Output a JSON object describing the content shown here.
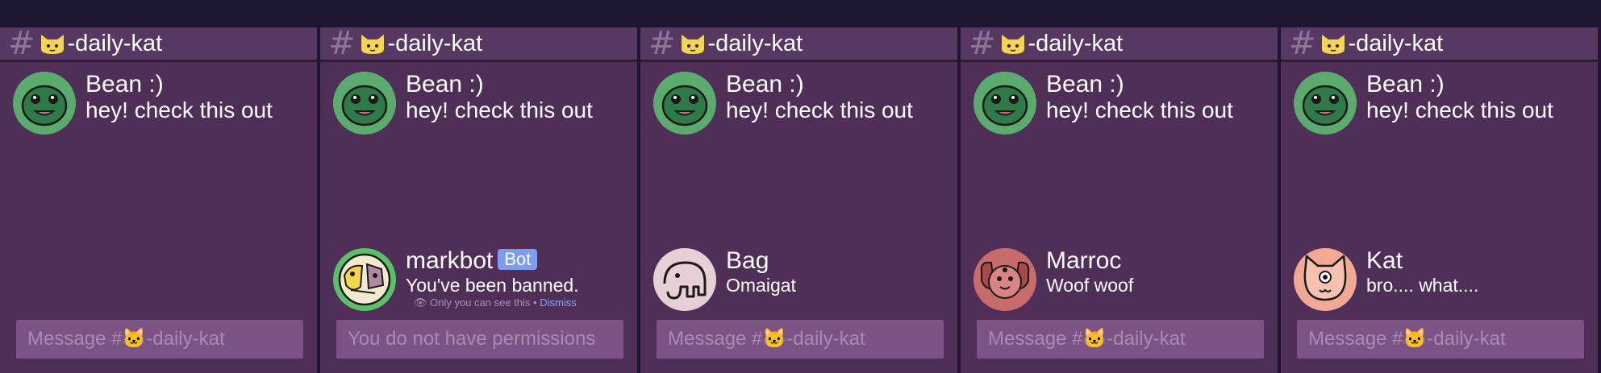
{
  "channel": {
    "hash": "#",
    "name": "-daily-kat"
  },
  "colors": {
    "background": "#4f2f58",
    "header": "#573863",
    "input": "#7b5384",
    "bot_badge": "#7f9cf5"
  },
  "panels": [
    {
      "first": {
        "author": "Bean :)",
        "text": "hey! check this out"
      },
      "input_placeholder": "Message #🐱-daily-kat"
    },
    {
      "first": {
        "author": "Bean :)",
        "text": "hey! check this out"
      },
      "reply": {
        "author": "markbot",
        "badge": "Bot",
        "text": "You've been banned.",
        "ephemeral": "Only you can see this •",
        "dismiss": "Dismiss"
      },
      "input_placeholder": "You do not have permissions"
    },
    {
      "first": {
        "author": "Bean :)",
        "text": "hey! check this out"
      },
      "reply": {
        "author": "Bag",
        "text": "Omaigat"
      },
      "input_placeholder": "Message #🐱-daily-kat"
    },
    {
      "first": {
        "author": "Bean :)",
        "text": "hey! check this out"
      },
      "reply": {
        "author": "Marroc",
        "text": "Woof woof"
      },
      "input_placeholder": "Message #🐱-daily-kat"
    },
    {
      "first": {
        "author": "Bean :)",
        "text": "hey! check this out"
      },
      "reply": {
        "author": "Kat",
        "text": "bro.... what...."
      },
      "input_placeholder": "Message #🐱-daily-kat"
    }
  ]
}
